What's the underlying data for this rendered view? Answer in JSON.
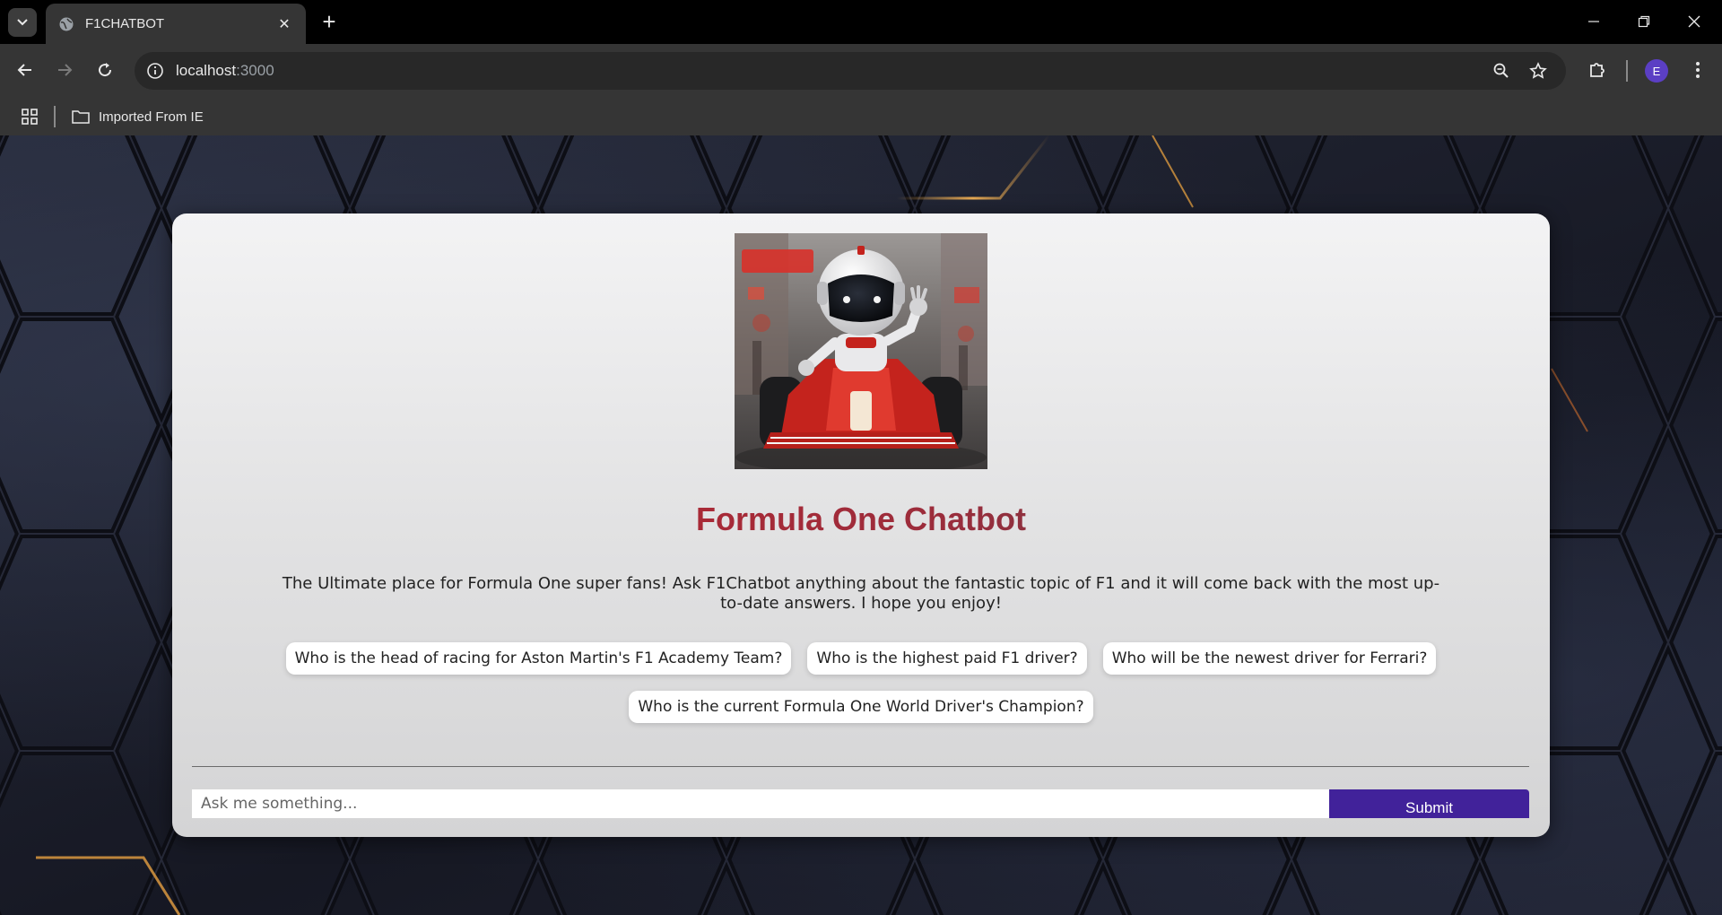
{
  "browser": {
    "tab_title": "F1CHATBOT",
    "url_host": "localhost",
    "url_port": ":3000",
    "bookmark_folder": "Imported From IE",
    "profile_initial": "E"
  },
  "page": {
    "title": "Formula One Chatbot",
    "description": "The Ultimate place for Formula One super fans! Ask F1Chatbot anything about the fantastic topic of F1 and it will come back with the most up-to-date answers. I hope you enjoy!",
    "prompts": [
      "Who is the head of racing for Aston Martin's F1 Academy Team?",
      "Who is the highest paid F1 driver?",
      "Who will be the newest driver for Ferrari?",
      "Who is the current Formula One World Driver's Champion?"
    ],
    "input_placeholder": "Ask me something...",
    "submit_label": "Submit"
  },
  "colors": {
    "submit_bg": "#41229a",
    "title_red": "#c4262e",
    "avatar": "#5b3fc4"
  }
}
